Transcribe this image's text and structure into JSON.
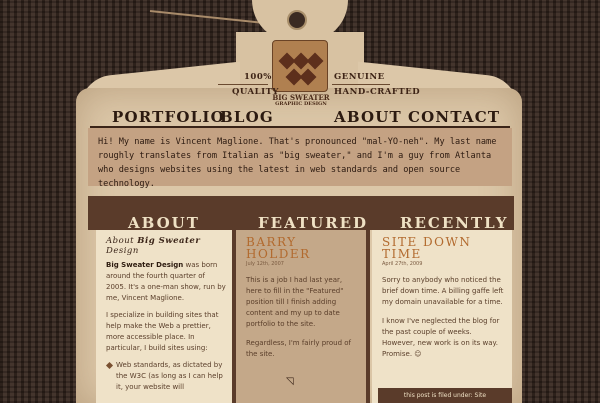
{
  "logo": {
    "tag_left_top": "100%",
    "tag_left_bottom": "Quality",
    "tag_right_top": "Genuine",
    "tag_right_bottom": "Hand-crafted",
    "brand": "Big Sweater",
    "brand_sub": "Graphic Design"
  },
  "nav": {
    "items": [
      {
        "label": "PORTFOLIO"
      },
      {
        "label": "BLOG"
      },
      {
        "label": "ABOUT"
      },
      {
        "label": "CONTACT"
      }
    ]
  },
  "intro": {
    "text": "Hi! My name is Vincent Maglione. That's pronounced \"mal-YO-neh\". My last name roughly translates from Italian as \"big sweater,\" and I'm a guy from Atlanta who designs websites using the latest in web standards and open source technology."
  },
  "columns": {
    "about": {
      "heading": "ABOUT",
      "title_prefix": "About",
      "title_emph": "Big Sweater",
      "title_line2": "Design",
      "p1_bold": "Big Sweater Design",
      "p1_rest": " was born around the fourth quarter of 2005. It's a one-man show, run by me, Vincent Maglione.",
      "p2": "I specialize in building sites that help make the Web a prettier, more accessible place. In particular, I build sites using:",
      "bullet1": "Web standards, as dictated by the W3C (as long as I can help it, your website will"
    },
    "featured": {
      "heading": "FEATURED",
      "title": "BARRY HOLDER",
      "date": "July 12th, 2007",
      "p1": "This is a job I had last year, here to fill in the \"Featured\" position till I finish adding content and my up to date portfolio to the site.",
      "p2": "Regardless, I'm fairly proud of the site."
    },
    "recently": {
      "heading": "RECENTLY",
      "title": "SITE DOWN TIME",
      "date": "April 27th, 2009",
      "p1": "Sorry to anybody who noticed the brief down time. A billing gaffe left my domain unavailable for a time.",
      "p2": "I know I've neglected the blog for the past couple of weeks. However, new work is on its way. Promise. ☺",
      "link": "this post is filed under: Site"
    }
  },
  "colors": {
    "background": "#3a2a22",
    "tag": "#dcc7a8",
    "band": "#5a3b2a",
    "accent": "#b26a2e"
  }
}
